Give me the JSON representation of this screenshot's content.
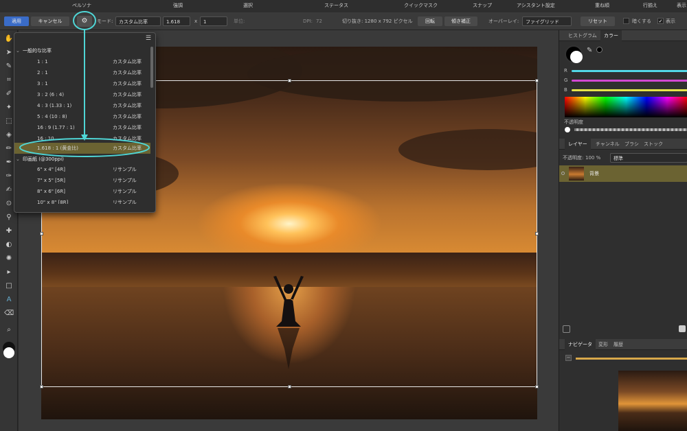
{
  "menubar": {
    "items": [
      "ペルソナ",
      "強調",
      "選択",
      "ステータス",
      "クイックマスク",
      "スナップ",
      "アシスタント設定",
      "重ね順",
      "行揃え",
      "表示"
    ]
  },
  "context": {
    "apply_label": "適用",
    "cancel_label": "キャンセル",
    "mode_label": "モード:",
    "mode_value": "カスタム比率",
    "ratio_w": "1.618",
    "ratio_x": "x",
    "ratio_h": "1",
    "unit_label": "単位:",
    "dpi_label": "DPI:",
    "dpi_value": "72",
    "crop_label": "切り抜き: 1280 x 792 ピクセル",
    "rotate_label": "回転",
    "straighten_label": "傾き補正",
    "overlay_label": "オーバーレイ:",
    "overlay_value": "ファイグリッド",
    "reset_label": "リセット",
    "darken_label": "暗くする",
    "show_label": "表示"
  },
  "popup": {
    "menu_icon": "hamburger-icon",
    "section1": "一般的な比率",
    "ratios": [
      {
        "ratio": "1 : 1",
        "type": "カスタム比率"
      },
      {
        "ratio": "2 : 1",
        "type": "カスタム比率"
      },
      {
        "ratio": "3 : 1",
        "type": "カスタム比率"
      },
      {
        "ratio": "3 : 2 (6 : 4)",
        "type": "カスタム比率"
      },
      {
        "ratio": "4 : 3 (1.33 : 1)",
        "type": "カスタム比率"
      },
      {
        "ratio": "5 : 4 (10 : 8)",
        "type": "カスタム比率"
      },
      {
        "ratio": "16 : 9 (1.77 : 1)",
        "type": "カスタム比率"
      },
      {
        "ratio": "16 : 10",
        "type": "カスタム比率"
      },
      {
        "ratio": "1.618 : 1 (黄金比)",
        "type": "カスタム比率"
      }
    ],
    "section2": "印画紙 (@300ppi)",
    "papers": [
      {
        "ratio": "6\" x 4\" [4R]",
        "type": "リサンプル"
      },
      {
        "ratio": "7\" x 5\" [5R]",
        "type": "リサンプル"
      },
      {
        "ratio": "8\" x 6\" [6R]",
        "type": "リサンプル"
      },
      {
        "ratio": "10\" x 8\" [8R]",
        "type": "リサンプル"
      }
    ]
  },
  "panels": {
    "top_tabs": [
      "ヒストグラム",
      "カラー"
    ],
    "channels": [
      "R",
      "G",
      "B"
    ],
    "opacity_label": "不透明度",
    "layer_tabs": [
      "レイヤー",
      "チャンネル",
      "ブラシ",
      "ストック"
    ],
    "layer_opacity": "不透明度:",
    "layer_opacity_value": "100 %",
    "blend_mode": "標準",
    "layer_name": "背景",
    "nav_tabs": [
      "ナビゲータ",
      "変形",
      "履歴"
    ]
  },
  "colors": {
    "highlight": "#6b6332",
    "annotation": "#4fd6d6",
    "r": "#52d8e8",
    "g": "#d248d2",
    "b": "#e6e64a"
  }
}
